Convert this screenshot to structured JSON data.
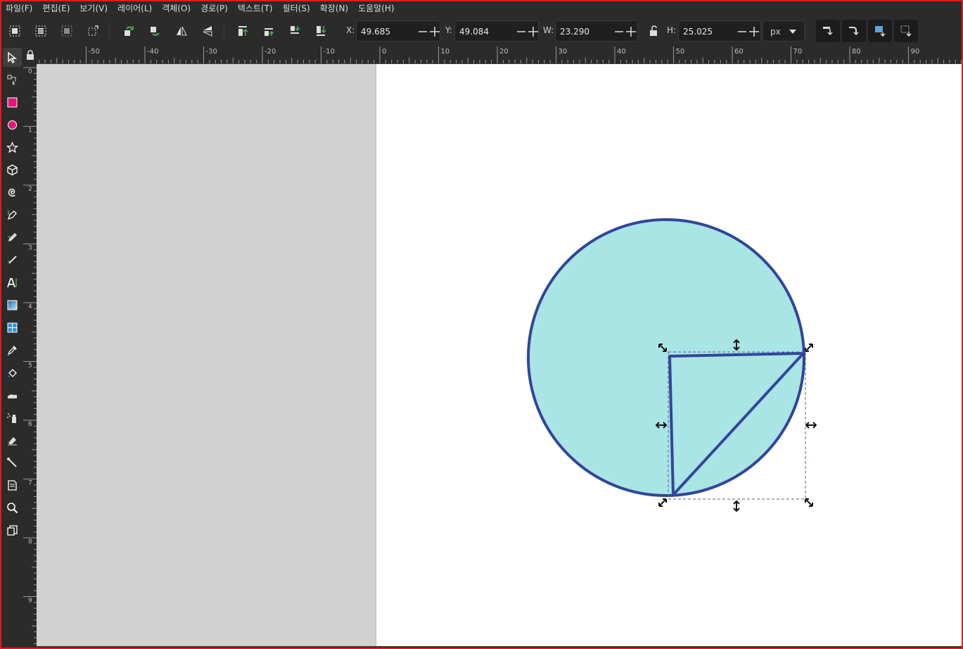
{
  "menu": {
    "items": [
      "파일(F)",
      "편집(E)",
      "보기(V)",
      "레이어(L)",
      "객체(O)",
      "경로(P)",
      "텍스트(T)",
      "필터(S)",
      "확장(N)",
      "도움말(H)"
    ]
  },
  "toolbar": {
    "x_label": "X:",
    "x_value": "49.685",
    "y_label": "Y:",
    "y_value": "49.084",
    "w_label": "W:",
    "w_value": "23.290",
    "h_label": "H:",
    "h_value": "25.025",
    "unit": "px"
  },
  "ruler": {
    "top_labels": [
      "-50",
      "-40",
      "-30",
      "-20",
      "-10",
      "0",
      "10",
      "20",
      "30",
      "40",
      "50",
      "60",
      "70",
      "80",
      "90"
    ],
    "left_labels": [
      "0",
      "1",
      "2",
      "3",
      "4",
      "5",
      "6",
      "7",
      "8",
      "9"
    ]
  },
  "colors": {
    "fill": "#a9e5e4",
    "stroke": "#32459b",
    "accent_rect": "#e3157e",
    "frame": "#e3191d"
  },
  "tools": [
    "selector-tool",
    "node-tool",
    "rectangle-tool",
    "ellipse-tool",
    "star-tool",
    "3d-box-tool",
    "spiral-tool",
    "pen-tool",
    "pencil-tool",
    "calligraphy-tool",
    "text-tool",
    "gradient-tool",
    "mesh-tool",
    "dropper-tool",
    "paint-bucket-tool",
    "tweak-tool",
    "spray-tool",
    "eraser-tool",
    "connector-tool",
    "page-tool",
    "zoom-tool",
    "pages-tool"
  ]
}
